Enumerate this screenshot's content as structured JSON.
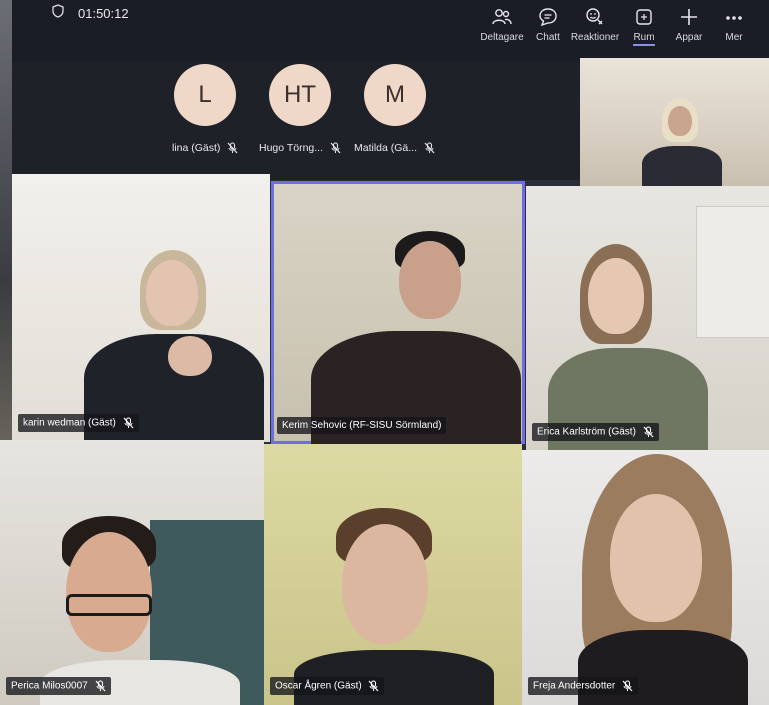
{
  "call": {
    "timer": "01:50:12"
  },
  "toolbar": [
    {
      "label": "Deltagare",
      "icon": "participants-icon"
    },
    {
      "label": "Chatt",
      "icon": "chat-icon"
    },
    {
      "label": "Reaktioner",
      "icon": "reactions-icon"
    },
    {
      "label": "Rum",
      "icon": "rooms-icon",
      "active": true
    },
    {
      "label": "Appar",
      "icon": "plus-icon"
    },
    {
      "label": "Mer",
      "icon": "more-icon"
    }
  ],
  "audio_only": [
    {
      "initials": "L",
      "name": "lina (Gäst)"
    },
    {
      "initials": "HT",
      "name": "Hugo Törng..."
    },
    {
      "initials": "M",
      "name": "Matilda (Gä..."
    }
  ],
  "tiles": [
    {
      "name": "karin wedman (Gäst)"
    },
    {
      "name": "Kerim Sehovic (RF-SISU Sörmland)"
    },
    {
      "name": "Erica Karlström (Gäst)"
    },
    {
      "name": "Perica Milos0007"
    },
    {
      "name": "Oscar Ågren (Gäst)"
    },
    {
      "name": "Freja Andersdotter"
    }
  ],
  "colors": {
    "accent": "#6d6fe0",
    "avatar_bg": "#f0d8c8"
  }
}
